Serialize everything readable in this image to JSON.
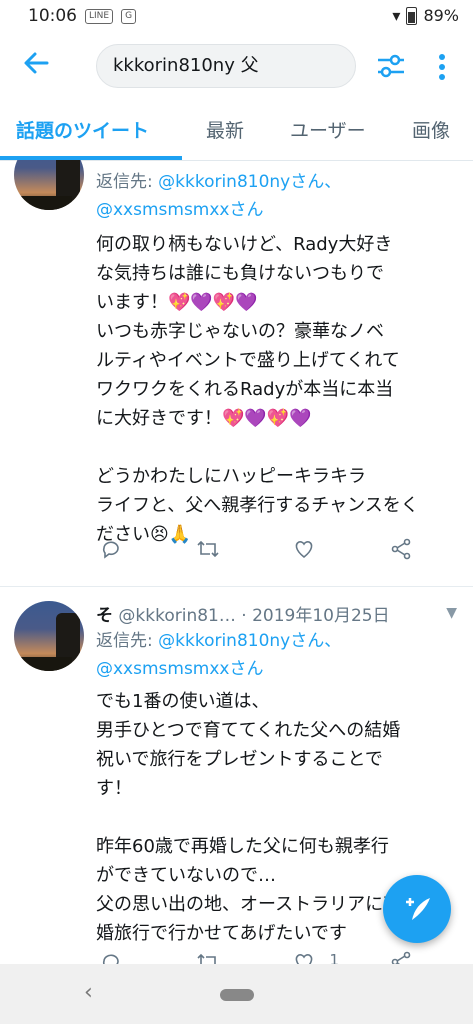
{
  "status_bar": {
    "time": "10:06",
    "battery": "89%",
    "app_icons": [
      "LINE",
      "G"
    ]
  },
  "search": {
    "query": "kkkorin810ny 父"
  },
  "tabs": [
    {
      "label": "話題のツイート",
      "active": true
    },
    {
      "label": "最新",
      "active": false
    },
    {
      "label": "ユーザー",
      "active": false
    },
    {
      "label": "画像",
      "active": false
    }
  ],
  "tweets": [
    {
      "reply_prefix": "返信先: ",
      "mention1": "@kkkorin810nyさん、",
      "mention2": "@xxsmsmsmxxさん",
      "line1": "何の取り柄もないけど、Rady大好き",
      "line2": "な気持ちは誰にも負けないつもりで",
      "line3": "います！",
      "line4": "いつも赤字じゃないの？豪華なノベ",
      "line5": "ルティやイベントで盛り上げてくれて",
      "line6": "ワクワクをくれるRadyが本当に本当",
      "line7": "に大好きです！",
      "line8": "どうかわたしにハッピーキラキラ",
      "line9": "ライフと、父へ親孝行するチャンスをく",
      "line10": "ださい😣🙏"
    },
    {
      "name": "そ",
      "handle": "@kkkorin81…",
      "date": "· 2019年10月25日",
      "reply_prefix": "返信先: ",
      "mention1": "@kkkorin810nyさん、",
      "mention2": "@xxsmsmsmxxさん",
      "line1": "でも1番の使い道は、",
      "line2": "男手ひとつで育ててくれた父への結婚",
      "line3": "祝いで旅行をプレゼントすることで",
      "line4": "す！",
      "line5": "昨年60歳で再婚した父に何も親孝行",
      "line6": "ができていないので…",
      "line7": "父の思い出の地、オーストラリアに新",
      "line8": "婚旅行で行かせてあげたいです",
      "like_count": "1"
    }
  ],
  "colors": {
    "accent": "#1da1f2",
    "text": "#14171a",
    "muted": "#657786"
  }
}
